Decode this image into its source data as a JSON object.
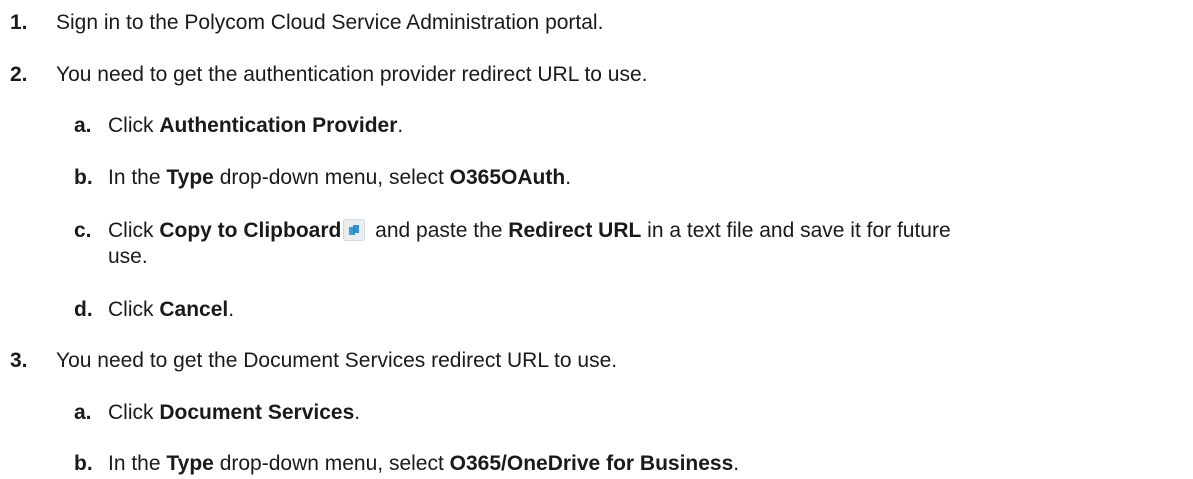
{
  "steps": [
    {
      "num": "1.",
      "parts": [
        "Sign in to the Polycom Cloud Service Administration portal."
      ]
    },
    {
      "num": "2.",
      "parts": [
        "You need to get the authentication provider redirect URL to use."
      ],
      "substeps": [
        {
          "num": "a.",
          "t1": "Click ",
          "b1": "Authentication Provider",
          "t2": "."
        },
        {
          "num": "b.",
          "t1": "In the ",
          "b1": "Type",
          "t2": " drop-down menu, select ",
          "b2": "O365OAuth",
          "t3": "."
        },
        {
          "num": "c.",
          "t1": "Click ",
          "b1": "Copy to Clipboard",
          "t2": " and paste the ",
          "b2": "Redirect URL",
          "t3": " in a text file and save it for future",
          "t4": "use."
        },
        {
          "num": "d.",
          "t1": "Click ",
          "b1": "Cancel",
          "t2": "."
        }
      ]
    },
    {
      "num": "3.",
      "parts": [
        "You need to get the Document Services redirect URL to use."
      ],
      "substeps": [
        {
          "num": "a.",
          "t1": "Click ",
          "b1": "Document Services",
          "t2": "."
        },
        {
          "num": "b.",
          "t1": "In the ",
          "b1": "Type",
          "t2": " drop-down menu, select ",
          "b2": "O365/OneDrive for Business",
          "t3": "."
        }
      ]
    }
  ],
  "icons": {
    "copy_clipboard": "copy-to-clipboard-icon"
  }
}
